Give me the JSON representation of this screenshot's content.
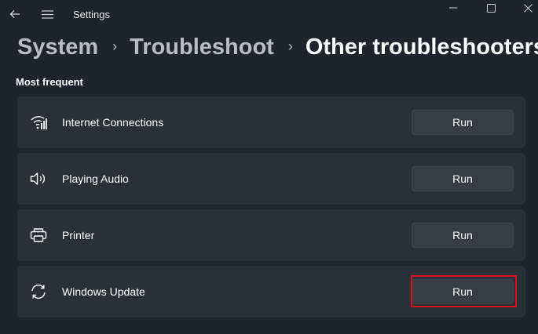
{
  "window": {
    "app_title": "Settings",
    "icons": {
      "back": "back-arrow-icon",
      "menu": "hamburger-menu-icon",
      "minimize": "minimize-icon",
      "maximize": "maximize-icon",
      "close": "close-icon"
    }
  },
  "breadcrumb": {
    "items": [
      "System",
      "Troubleshoot",
      "Other troubleshooters"
    ],
    "separator": "›"
  },
  "section": {
    "title": "Most frequent"
  },
  "troubleshooters": [
    {
      "label": "Internet Connections",
      "icon": "wifi-network-icon",
      "button_label": "Run",
      "highlighted": false
    },
    {
      "label": "Playing Audio",
      "icon": "speaker-icon",
      "button_label": "Run",
      "highlighted": false
    },
    {
      "label": "Printer",
      "icon": "printer-icon",
      "button_label": "Run",
      "highlighted": false
    },
    {
      "label": "Windows Update",
      "icon": "sync-refresh-icon",
      "button_label": "Run",
      "highlighted": true
    }
  ],
  "colors": {
    "background": "#1f232c",
    "card": "#2b2f38",
    "button": "#383c46",
    "highlight": "#d9141c"
  }
}
